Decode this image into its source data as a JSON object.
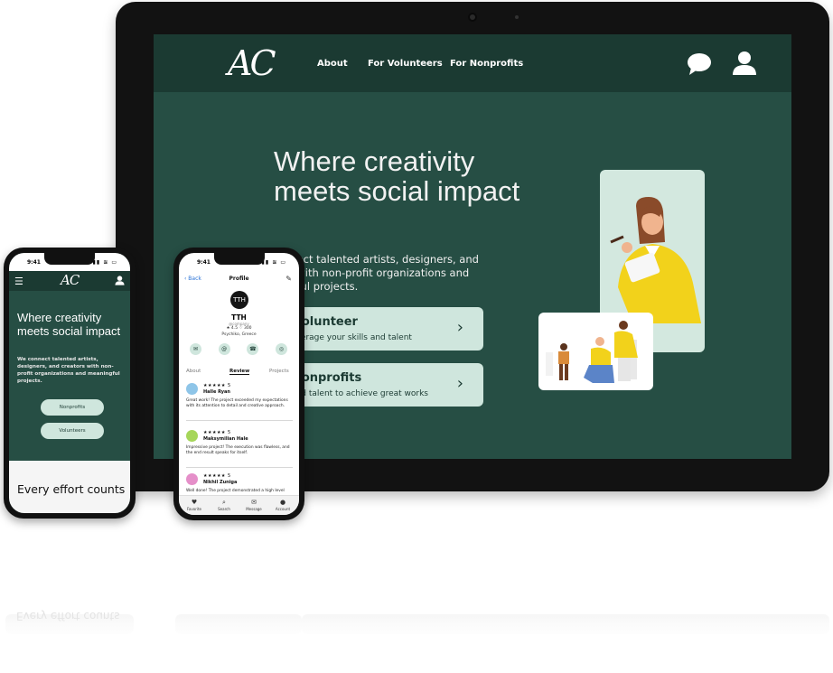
{
  "tablet": {
    "logo": "AC",
    "nav": [
      "About",
      "For Volunteers",
      "For Nonprofits"
    ],
    "hero_title": "Where creativity meets social impact",
    "hero_desc": "...nnect talented artists, designers, and ...rs with non-profit organizations and ...ngful projects.",
    "cards": [
      {
        "title": "...olunteer",
        "sub": "...verage your skills and talent",
        "chevron": "›"
      },
      {
        "title": "...onprofits",
        "sub": "...nd talent to achieve great works",
        "chevron": "›"
      }
    ],
    "icons": [
      "chat-icon",
      "user-icon"
    ]
  },
  "phone1": {
    "time": "9:41",
    "menu_icon": "☰",
    "logo": "AC",
    "hero_title": "Where creativity meets social impact",
    "hero_desc": "We connect talented artists, designers, and creators with non-profit organizations and meaningful projects.",
    "btn_nonprofits": "Nonprofits",
    "btn_volunteers": "Volunteers",
    "bottom_title": "Every effort counts"
  },
  "phone2": {
    "time": "9:41",
    "back": "‹ Back",
    "title": "Profile",
    "avatar": "TTH",
    "name": "TTH",
    "handle": "@company",
    "stats": "★ 4.5   ♡ 300",
    "location": "Psychiko, Greece",
    "tabs": [
      "About",
      "Review",
      "Projects"
    ],
    "reviews": [
      {
        "stars": "★★★★★ 5",
        "name": "Halle Ryan",
        "text": "Great work! The project exceeded my expectations with its attention to detail and creative approach.",
        "color": "#8ec5e8"
      },
      {
        "stars": "★★★★★ 5",
        "name": "Maksymilian Hale",
        "text": "Impressive project! The execution was flawless, and the end result speaks for itself.",
        "color": "#a6d65a"
      },
      {
        "stars": "★★★★★ 5",
        "name": "Nikhil Zuniga",
        "text": "Well done! The project demonstrated a high level",
        "color": "#e58fc9"
      }
    ],
    "tabbar": [
      {
        "icon": "♥",
        "label": "Favorite"
      },
      {
        "icon": "⌕",
        "label": "Search"
      },
      {
        "icon": "✉",
        "label": "Message"
      },
      {
        "icon": "●",
        "label": "Account"
      }
    ]
  },
  "reflection": {
    "text": "Every effort counts"
  },
  "colors": {
    "dark_green": "#1b3a32",
    "mid_green": "#264e44",
    "mint": "#cfe6dd",
    "yellow": "#f2d21b"
  }
}
